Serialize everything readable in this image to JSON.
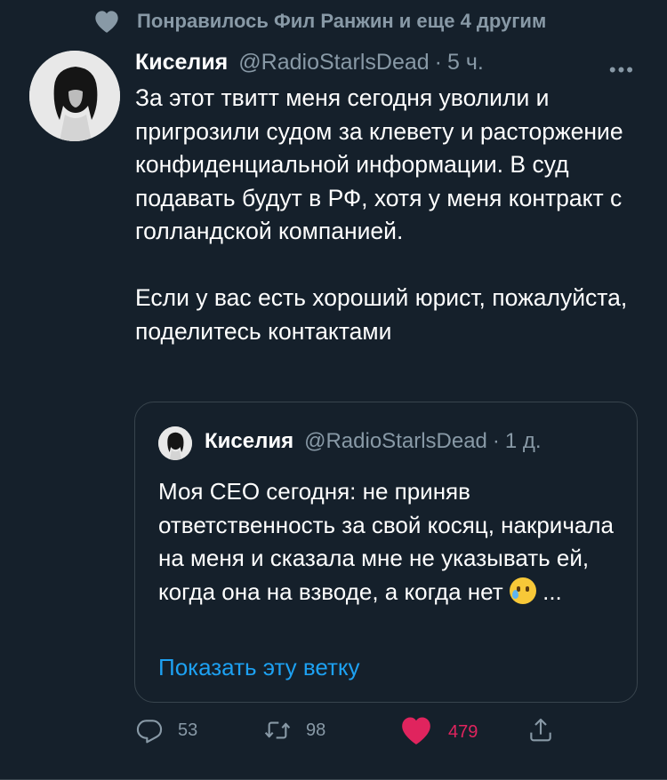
{
  "social_context": {
    "text": "Понравилось Фил Ранжин и еще 4 другим",
    "icon": "heart-icon"
  },
  "tweet": {
    "author_name": "Киселия",
    "author_handle": "@RadioStarlsDead",
    "separator": "·",
    "time": "5 ч.",
    "more_label": "•••",
    "paragraphs": [
      "За этот твитт меня сегодня уволили и пригрозили судом за клевету и расторжение конфиденциальной информации. В суд подавать будут в РФ, хотя у меня контракт с голландской компанией.",
      "Если у вас есть хороший юрист, пожалуйста, поделитесь контактами"
    ]
  },
  "quote": {
    "author_name": "Киселия",
    "author_handle": "@RadioStarlsDead",
    "separator": "·",
    "time": "1 д.",
    "text": "Моя СЕО сегодня: не приняв ответственность за свой косяц, накричала на меня и сказала мне не указывать ей, когда она на взводе, а когда нет",
    "ellipsis": "...",
    "emoji": "crying-face-emoji",
    "show_thread_label": "Показать эту ветку"
  },
  "actions": {
    "reply_count": "53",
    "retweet_count": "98",
    "like_count": "479",
    "like_color": "#e0245e",
    "accent_color": "#1da1f2",
    "background_color": "#15202b"
  }
}
